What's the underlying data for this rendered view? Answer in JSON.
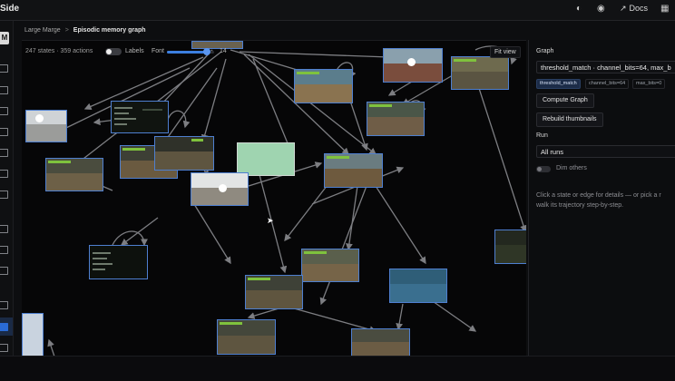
{
  "app": {
    "title": "Side"
  },
  "topbar": {
    "docs_label": "Docs",
    "icons": [
      "gauge-icon",
      "discord-icon",
      "external-link-icon",
      "sidebar-toggle-icon"
    ]
  },
  "rail": {
    "avatar_letter": "M",
    "active_item_index": 14
  },
  "breadcrumb": {
    "parent": "Large Marge",
    "separator": ">",
    "current": "Episodic memory graph"
  },
  "canvas_toolbar": {
    "counts": "247 states · 359 actions",
    "labels_label": "Labels",
    "labels_on": false,
    "font_label": "Font",
    "font_value": "14",
    "fit_view_label": "Fit view"
  },
  "panel": {
    "graph_heading": "Graph",
    "graph_select_value": "threshold_match · channel_bits=64, max_b",
    "chips": [
      {
        "label": "threshold_match",
        "active": true
      },
      {
        "label": "channel_bits=64",
        "active": false
      },
      {
        "label": "max_bits=0",
        "active": false
      }
    ],
    "compute_graph_label": "Compute Graph",
    "rebuild_thumbnails_label": "Rebuild thumbnails",
    "run_heading": "Run",
    "run_select_value": "All runs",
    "dim_others_label": "Dim others",
    "help_line1": "Click a state or edge for details — or pick a r",
    "help_line2": "walk its trajectory step-by-step."
  },
  "colors": {
    "accent": "#3c7fe0",
    "edge": "#8a8b90",
    "node_border": "#4e7fd0",
    "chip_active_bg": "#1c2c48"
  }
}
